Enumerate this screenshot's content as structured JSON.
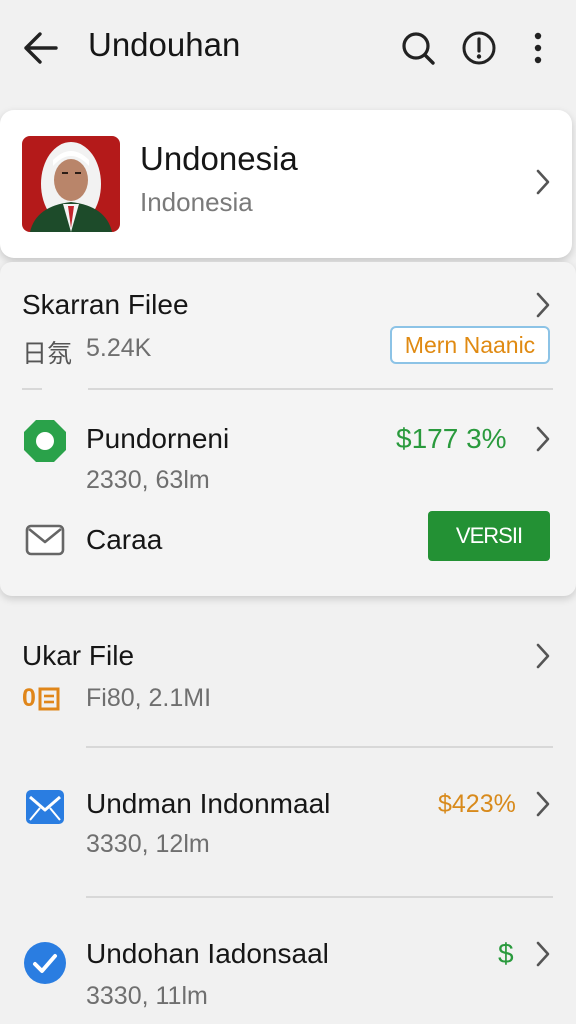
{
  "header": {
    "title": "Undouhan",
    "icons": [
      "back-arrow-icon",
      "search-icon",
      "info-icon",
      "more-vert-icon"
    ]
  },
  "profile": {
    "name": "Undonesia",
    "subtitle": "Indonesia"
  },
  "section1": {
    "title": "Skarran Filee",
    "meta_glyph": "日氛",
    "meta_value": "5.24K",
    "badge": "Mern Naanic",
    "item1": {
      "title": "Pundorneni",
      "sub": "2330, 63lm",
      "value": "$177 3%"
    },
    "item2": {
      "title": "Caraa",
      "button": "VERSII"
    }
  },
  "list": [
    {
      "title": "Ukar File",
      "icon_text": "0",
      "sub": "Fi80, 2.1MI"
    },
    {
      "title": "Undman Indonmaal",
      "sub": "3330, 12lm",
      "value": "$423%"
    },
    {
      "title": "Undohan Iadonsaal",
      "sub": "3330, 11lm",
      "value": "$"
    }
  ],
  "colors": {
    "green": "#2a9a3d",
    "orange": "#d88a1c",
    "button_green": "#239134",
    "blue": "#2a7de1"
  }
}
